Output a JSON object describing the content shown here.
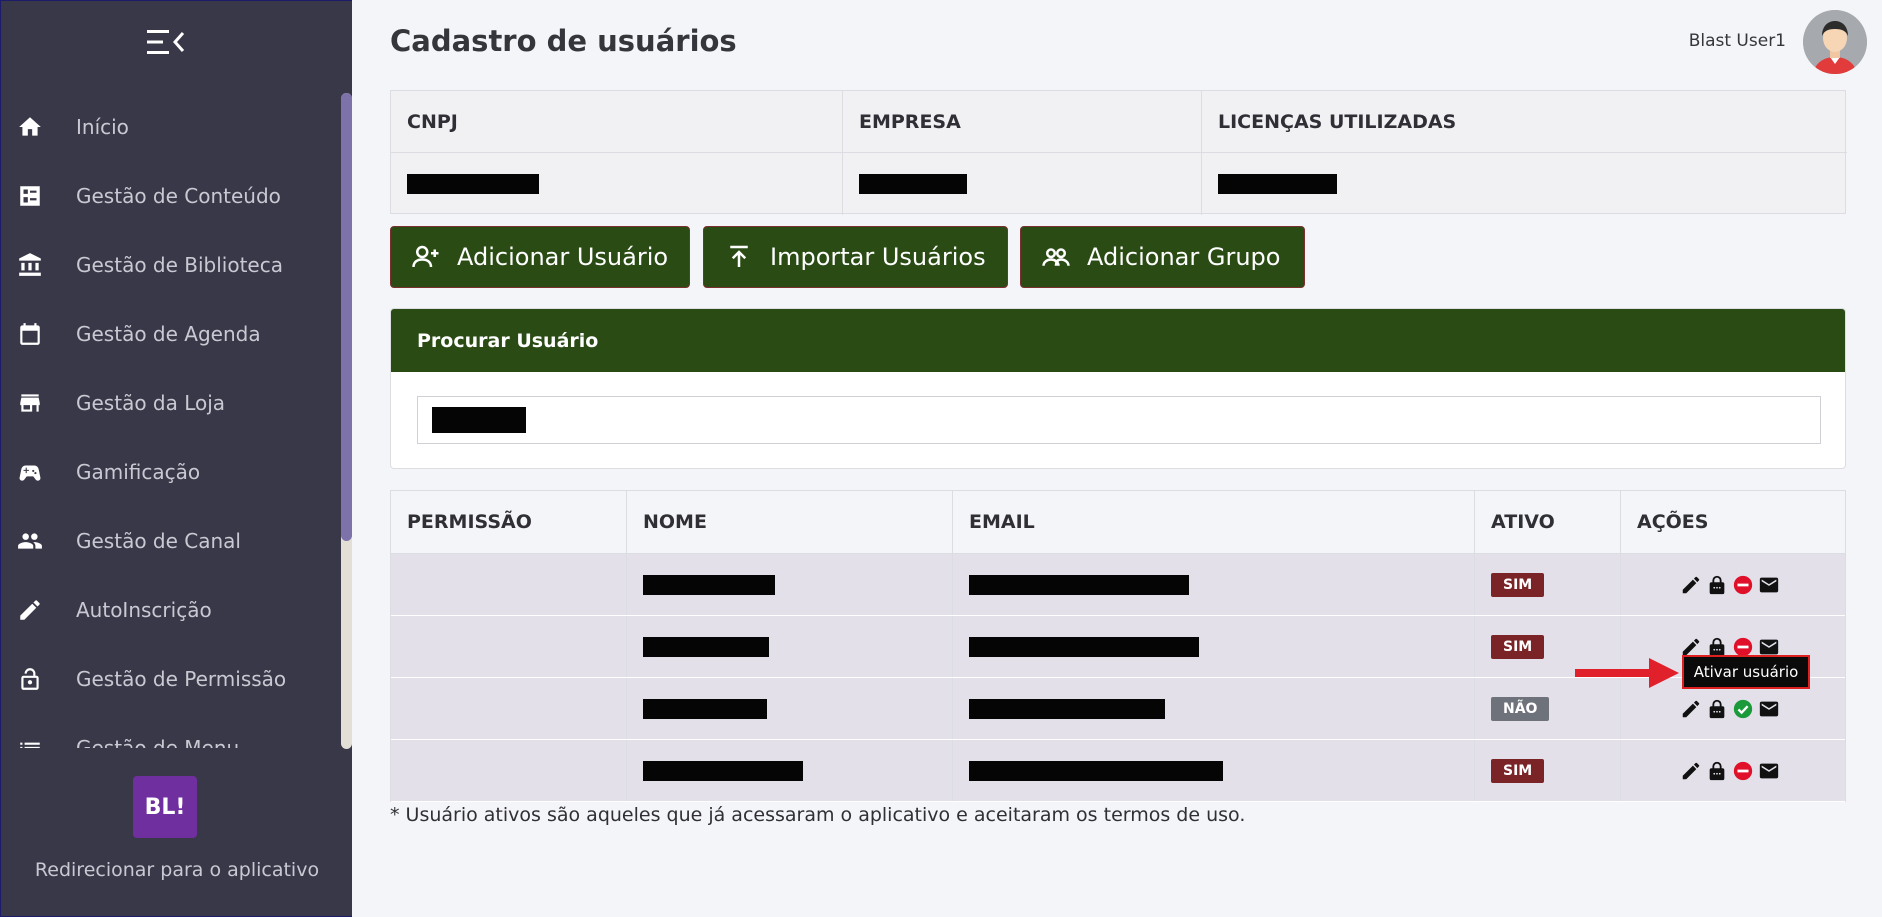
{
  "sidebar": {
    "items": [
      {
        "label": "Início",
        "icon": "home-icon"
      },
      {
        "label": "Gestão de Conteúdo",
        "icon": "content-icon"
      },
      {
        "label": "Gestão de Biblioteca",
        "icon": "library-icon"
      },
      {
        "label": "Gestão de Agenda",
        "icon": "calendar-icon"
      },
      {
        "label": "Gestão da Loja",
        "icon": "store-icon"
      },
      {
        "label": "Gamificação",
        "icon": "gamepad-icon"
      },
      {
        "label": "Gestão de Canal",
        "icon": "people-icon"
      },
      {
        "label": "AutoInscrição",
        "icon": "pencil-icon"
      },
      {
        "label": "Gestão de Permissão",
        "icon": "lock-icon"
      },
      {
        "label": "Gestão de Menu",
        "icon": "list-icon"
      }
    ],
    "logo_text": "BL!",
    "redirect_label": "Redirecionar para o aplicativo"
  },
  "header": {
    "title": "Cadastro de usuários",
    "user_name": "Blast User1"
  },
  "company": {
    "headers": [
      "CNPJ",
      "EMPRESA",
      "LICENÇAS UTILIZADAS"
    ]
  },
  "buttons": {
    "add_user": "Adicionar Usuário",
    "import_users": "Importar Usuários",
    "add_group": "Adicionar Grupo"
  },
  "search": {
    "title": "Procurar Usuário"
  },
  "users_table": {
    "headers": [
      "PERMISSÃO",
      "NOME",
      "EMAIL",
      "ATIVO",
      "AÇÕES"
    ],
    "rows": [
      {
        "active": "SIM"
      },
      {
        "active": "SIM"
      },
      {
        "active": "NÃO"
      },
      {
        "active": "SIM"
      }
    ]
  },
  "footnote": "* Usuário ativos são aqueles que já acessaram o aplicativo e aceitaram os termos de uso.",
  "tooltip": "Ativar usuário",
  "colors": {
    "sidebar": "#393848",
    "primary_green": "#2a4c14",
    "badge_yes": "#7b2428",
    "badge_no": "#6e737b",
    "block_red": "#e0102a",
    "activate_green": "#1a9a3a"
  }
}
